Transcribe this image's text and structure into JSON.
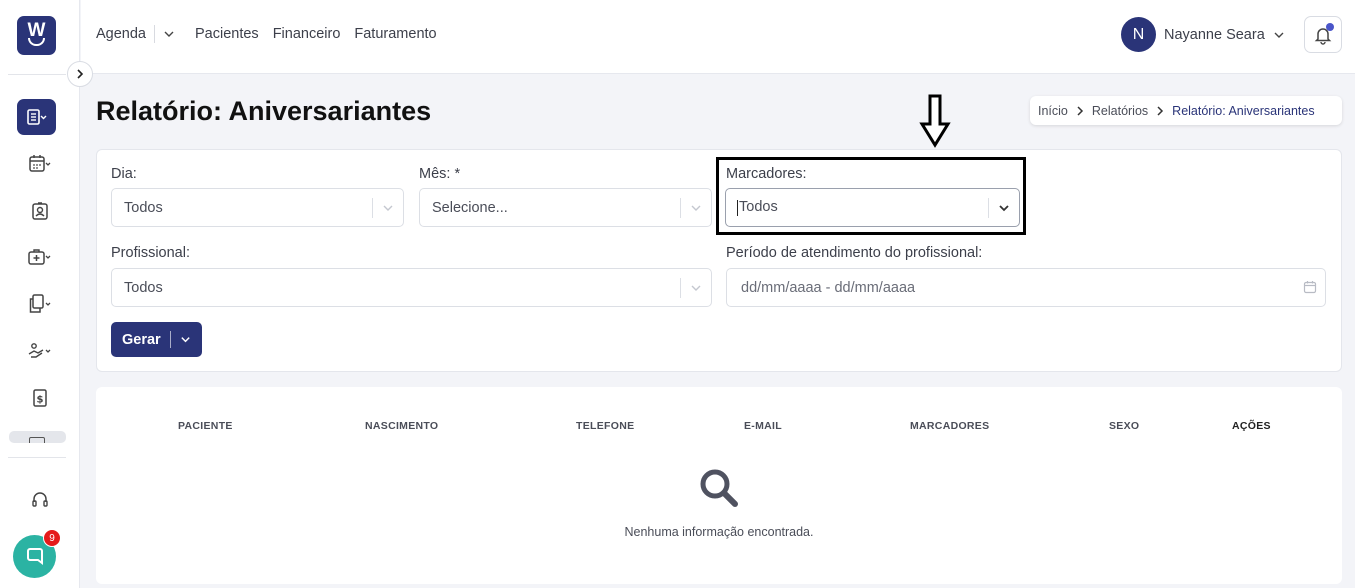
{
  "app": {
    "logo_letter": "W"
  },
  "nav": {
    "items": [
      "Agenda",
      "Pacientes",
      "Financeiro",
      "Faturamento"
    ]
  },
  "user": {
    "initial": "N",
    "name": "Nayanne Seara"
  },
  "page": {
    "title": "Relatório: Aniversariantes"
  },
  "breadcrumb": [
    "Início",
    "Relatórios",
    "Relatório: Aniversariantes"
  ],
  "filters": {
    "dia": {
      "label": "Dia:",
      "value": "Todos"
    },
    "mes": {
      "label": "Mês: *",
      "placeholder": "Selecione..."
    },
    "marcadores": {
      "label": "Marcadores:",
      "value": "Todos"
    },
    "profissional": {
      "label": "Profissional:",
      "value": "Todos"
    },
    "periodo": {
      "label": "Período de atendimento do profissional:",
      "placeholder": "dd/mm/aaaa - dd/mm/aaaa"
    },
    "generate_label": "Gerar"
  },
  "table": {
    "columns": [
      "PACIENTE",
      "NASCIMENTO",
      "TELEFONE",
      "E-MAIL",
      "MARCADORES",
      "SEXO",
      "AÇÕES"
    ],
    "empty_message": "Nenhuma informação encontrada."
  },
  "chat": {
    "badge_count": "9"
  },
  "sidebar": {
    "icons": [
      "reports-icon",
      "calendar-icon",
      "patient-icon",
      "medical-kit-icon",
      "documents-icon",
      "handshake-icon",
      "finance-icon",
      "headset-icon"
    ]
  },
  "colors": {
    "primary": "#2a3478",
    "chat": "#2bb3a3",
    "badge": "#e51b1b"
  }
}
